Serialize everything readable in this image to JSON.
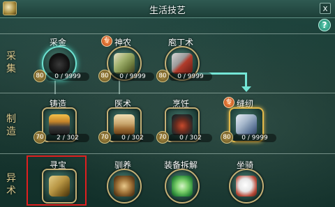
{
  "window": {
    "title": "生活技艺",
    "close_label": "x",
    "help_label": "?"
  },
  "categories": {
    "gather": "采\n集",
    "craft": "制\n造",
    "special": "异\n术"
  },
  "skills": {
    "caijin": {
      "label": "采金",
      "level": "80",
      "progress": "0 / 9999"
    },
    "shennong": {
      "label": "神农",
      "level": "80",
      "progress": "0 / 9999",
      "badge": "专"
    },
    "paoding": {
      "label": "庖丁术",
      "level": "80",
      "progress": "0 / 9999"
    },
    "zhuzao": {
      "label": "铸造",
      "level": "70",
      "progress": "2 / 302"
    },
    "yishu": {
      "label": "医术",
      "level": "70",
      "progress": "0 / 302"
    },
    "pengren": {
      "label": "烹饪",
      "level": "70",
      "progress": "0 / 302"
    },
    "fengren": {
      "label": "缝纫",
      "level": "80",
      "progress": "0 / 9999",
      "badge": "专"
    },
    "xunbao": {
      "label": "寻宝"
    },
    "xunyang": {
      "label": "驯养"
    },
    "chaijie": {
      "label": "装备拆解"
    },
    "zuoqi": {
      "label": "坐骑"
    }
  },
  "colors": {
    "selection": "#e01f1f",
    "connector": "#74e6d6",
    "category_text": "#d9c88d"
  }
}
